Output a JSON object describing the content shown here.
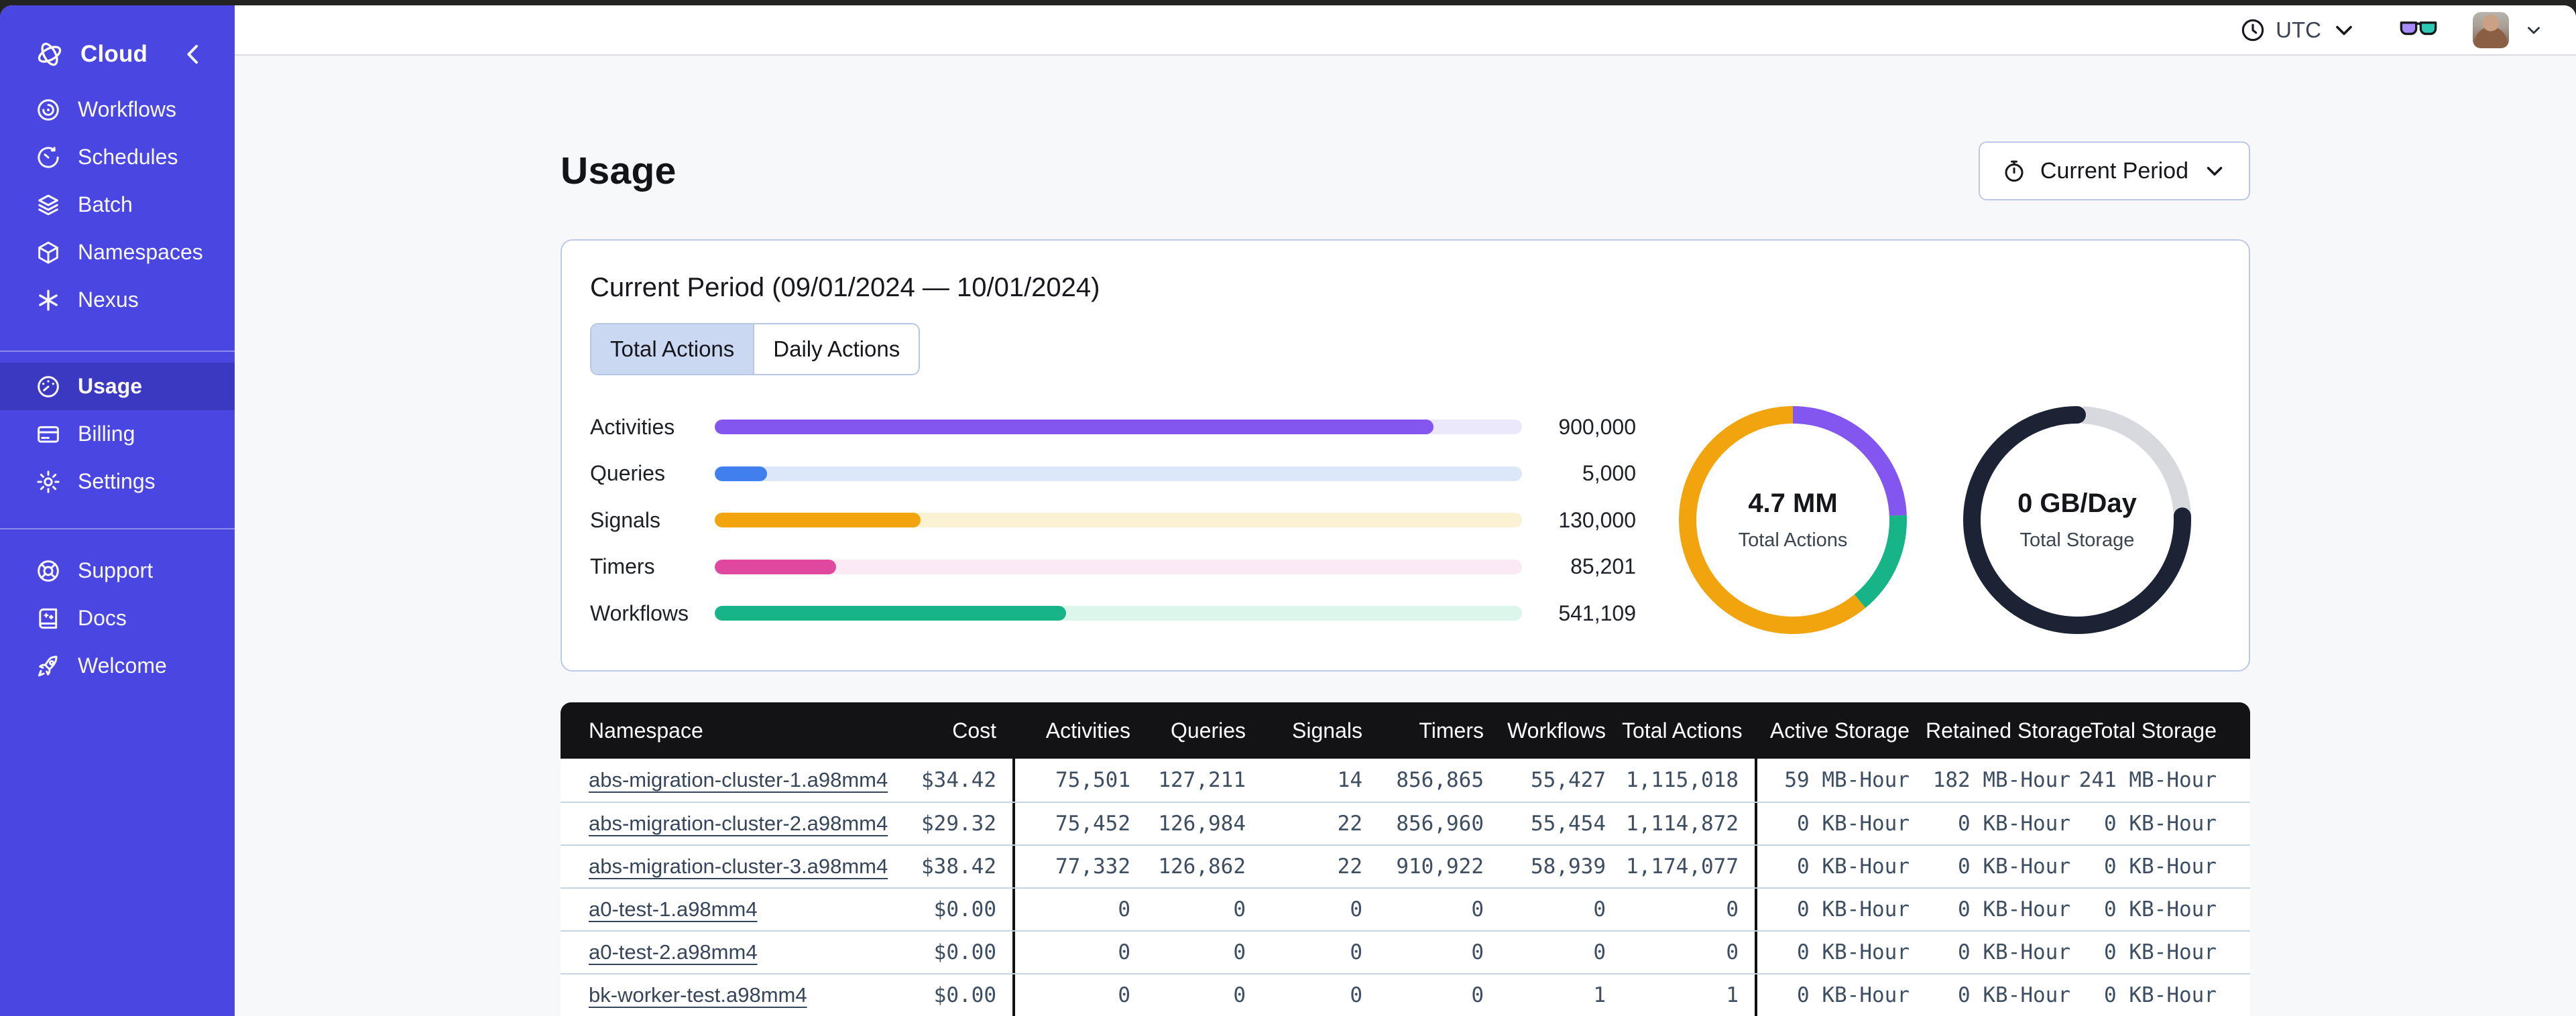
{
  "sidebar": {
    "brand": {
      "label": "Cloud",
      "icon": "temporal-logo-icon",
      "collapse_icon": "chevron-left-icon"
    },
    "groups": [
      {
        "items": [
          {
            "label": "Workflows",
            "icon": "workflows-icon",
            "active": false
          },
          {
            "label": "Schedules",
            "icon": "schedules-clock-icon",
            "active": false
          },
          {
            "label": "Batch",
            "icon": "batch-layers-icon",
            "active": false
          },
          {
            "label": "Namespaces",
            "icon": "namespaces-cube-icon",
            "active": false
          },
          {
            "label": "Nexus",
            "icon": "nexus-asterisk-icon",
            "active": false
          }
        ]
      },
      {
        "items": [
          {
            "label": "Usage",
            "icon": "usage-gauge-icon",
            "active": true
          },
          {
            "label": "Billing",
            "icon": "billing-card-icon",
            "active": false
          },
          {
            "label": "Settings",
            "icon": "settings-gear-icon",
            "active": false
          }
        ]
      },
      {
        "items": [
          {
            "label": "Support",
            "icon": "support-lifebuoy-icon",
            "active": false
          },
          {
            "label": "Docs",
            "icon": "docs-book-icon",
            "active": false
          },
          {
            "label": "Welcome",
            "icon": "welcome-rocket-icon",
            "active": false
          }
        ]
      }
    ]
  },
  "topbar": {
    "timezone": "UTC"
  },
  "page": {
    "title": "Usage",
    "period_selector": {
      "label": "Current Period"
    }
  },
  "usage_card": {
    "title": "Current Period (09/01/2024 — 10/01/2024)",
    "tabs": [
      {
        "label": "Total Actions",
        "active": true
      },
      {
        "label": "Daily Actions",
        "active": false
      }
    ],
    "chart_data": {
      "type": "bar",
      "categories": [
        "Activities",
        "Queries",
        "Signals",
        "Timers",
        "Workflows"
      ],
      "values": [
        900000,
        5000,
        130000,
        85201,
        541109
      ],
      "value_labels": [
        "900,000",
        "5,000",
        "130,000",
        "85,201",
        "541,109"
      ],
      "fill_percents": [
        89,
        6.5,
        25.5,
        15,
        43.5
      ],
      "colors": [
        "#8456F0",
        "#4080EE",
        "#F2A40E",
        "#E0479E",
        "#16B486"
      ],
      "track_colors": [
        "#ECE8FB",
        "#DCE8FA",
        "#FBF2D4",
        "#FBE9F5",
        "#DCF6EC"
      ]
    },
    "donuts": [
      {
        "name": "total-actions",
        "value": "4.7 MM",
        "label": "Total Actions",
        "segments": [
          {
            "color": "#8456F0",
            "start_pct": 0,
            "pct": 24.3,
            "rounded": false
          },
          {
            "color": "#16B486",
            "start_pct": 24.3,
            "pct": 14.7,
            "rounded": false
          },
          {
            "color": "#F2A40E",
            "start_pct": 39,
            "pct": 61,
            "rounded": false
          }
        ]
      },
      {
        "name": "total-storage",
        "value": "0 GB/Day",
        "label": "Total Storage",
        "segments": [
          {
            "color": "#D7D9DE",
            "start_pct": 0.8,
            "pct": 23.6,
            "rounded": false
          },
          {
            "color": "#1B2334",
            "start_pct": 24.4,
            "pct": 76,
            "rounded": true
          }
        ]
      }
    ]
  },
  "table": {
    "columns": [
      "Namespace",
      "Cost",
      "Activities",
      "Queries",
      "Signals",
      "Timers",
      "Workflows",
      "Total Actions",
      "Active Storage",
      "Retained Storage",
      "Total Storage"
    ],
    "rows": [
      [
        "abs-migration-cluster-1.a98mm4",
        "$34.42",
        "75,501",
        "127,211",
        "14",
        "856,865",
        "55,427",
        "1,115,018",
        "59 MB-Hour",
        "182 MB-Hour",
        "241 MB-Hour"
      ],
      [
        "abs-migration-cluster-2.a98mm4",
        "$29.32",
        "75,452",
        "126,984",
        "22",
        "856,960",
        "55,454",
        "1,114,872",
        "0 KB-Hour",
        "0 KB-Hour",
        "0 KB-Hour"
      ],
      [
        "abs-migration-cluster-3.a98mm4",
        "$38.42",
        "77,332",
        "126,862",
        "22",
        "910,922",
        "58,939",
        "1,174,077",
        "0 KB-Hour",
        "0 KB-Hour",
        "0 KB-Hour"
      ],
      [
        "a0-test-1.a98mm4",
        "$0.00",
        "0",
        "0",
        "0",
        "0",
        "0",
        "0",
        "0 KB-Hour",
        "0 KB-Hour",
        "0 KB-Hour"
      ],
      [
        "a0-test-2.a98mm4",
        "$0.00",
        "0",
        "0",
        "0",
        "0",
        "0",
        "0",
        "0 KB-Hour",
        "0 KB-Hour",
        "0 KB-Hour"
      ],
      [
        "bk-worker-test.a98mm4",
        "$0.00",
        "0",
        "0",
        "0",
        "0",
        "1",
        "1",
        "0 KB-Hour",
        "0 KB-Hour",
        "0 KB-Hour"
      ]
    ]
  }
}
